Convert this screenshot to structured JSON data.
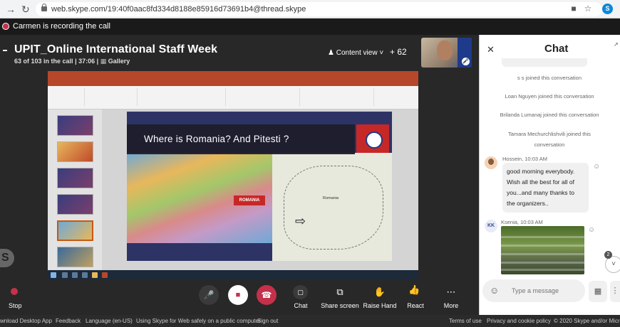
{
  "browser": {
    "url": "web.skype.com/19:40f0aac8fd334d8188e85916d73691b4@thread.skype",
    "back_icon": "arrow-right-icon",
    "reload_icon": "reload-icon"
  },
  "recording": {
    "text": "Carmen is recording the call"
  },
  "call": {
    "title": "UPIT_Online International Staff Week",
    "participants": "63 of 103 in the call",
    "duration": "37:06",
    "separator": "|",
    "gallery_label": "Gallery",
    "content_view_label": "Content view",
    "participant_count": "+ 62"
  },
  "slide": {
    "title": "Where is Romania? And Pitesti ?",
    "romania_tag": "ROMANIA",
    "map_label": "Romania"
  },
  "controls": {
    "stop": "Stop",
    "chat": "Chat",
    "share_screen": "Share screen",
    "raise_hand": "Raise Hand",
    "react": "React",
    "more": "More"
  },
  "chat": {
    "title": "Chat",
    "system_messages": [
      "s s joined this conversation",
      "Loan Nguyen joined this conversation",
      "Brilanda Lumanaj joined this conversation",
      "Tamara Mechurchlishvili joined this",
      "conversation"
    ],
    "messages": [
      {
        "sender": "Hossein, 10:03 AM",
        "text": [
          "good morning everybody.",
          "Wish all the best for all of",
          "you...and many thanks to",
          "the organizers.."
        ]
      },
      {
        "sender": "Ksenia, 10:03 AM",
        "initials": "KK"
      }
    ],
    "unread_count": "2",
    "input_placeholder": "Type a message"
  },
  "footer": {
    "download": "wnload Desktop App",
    "feedback": "Feedback",
    "language": "Language (en-US)",
    "safety": "Using Skype for Web safely on a public computer",
    "sign_out": "Sign out",
    "terms": "Terms of use",
    "privacy": "Privacy and cookie policy",
    "copyright": "© 2020 Skype and/or Microso"
  },
  "colors": {
    "accent_red": "#c4314b",
    "skype_blue": "#0c88d6",
    "ppt_orange": "#b7472a"
  }
}
